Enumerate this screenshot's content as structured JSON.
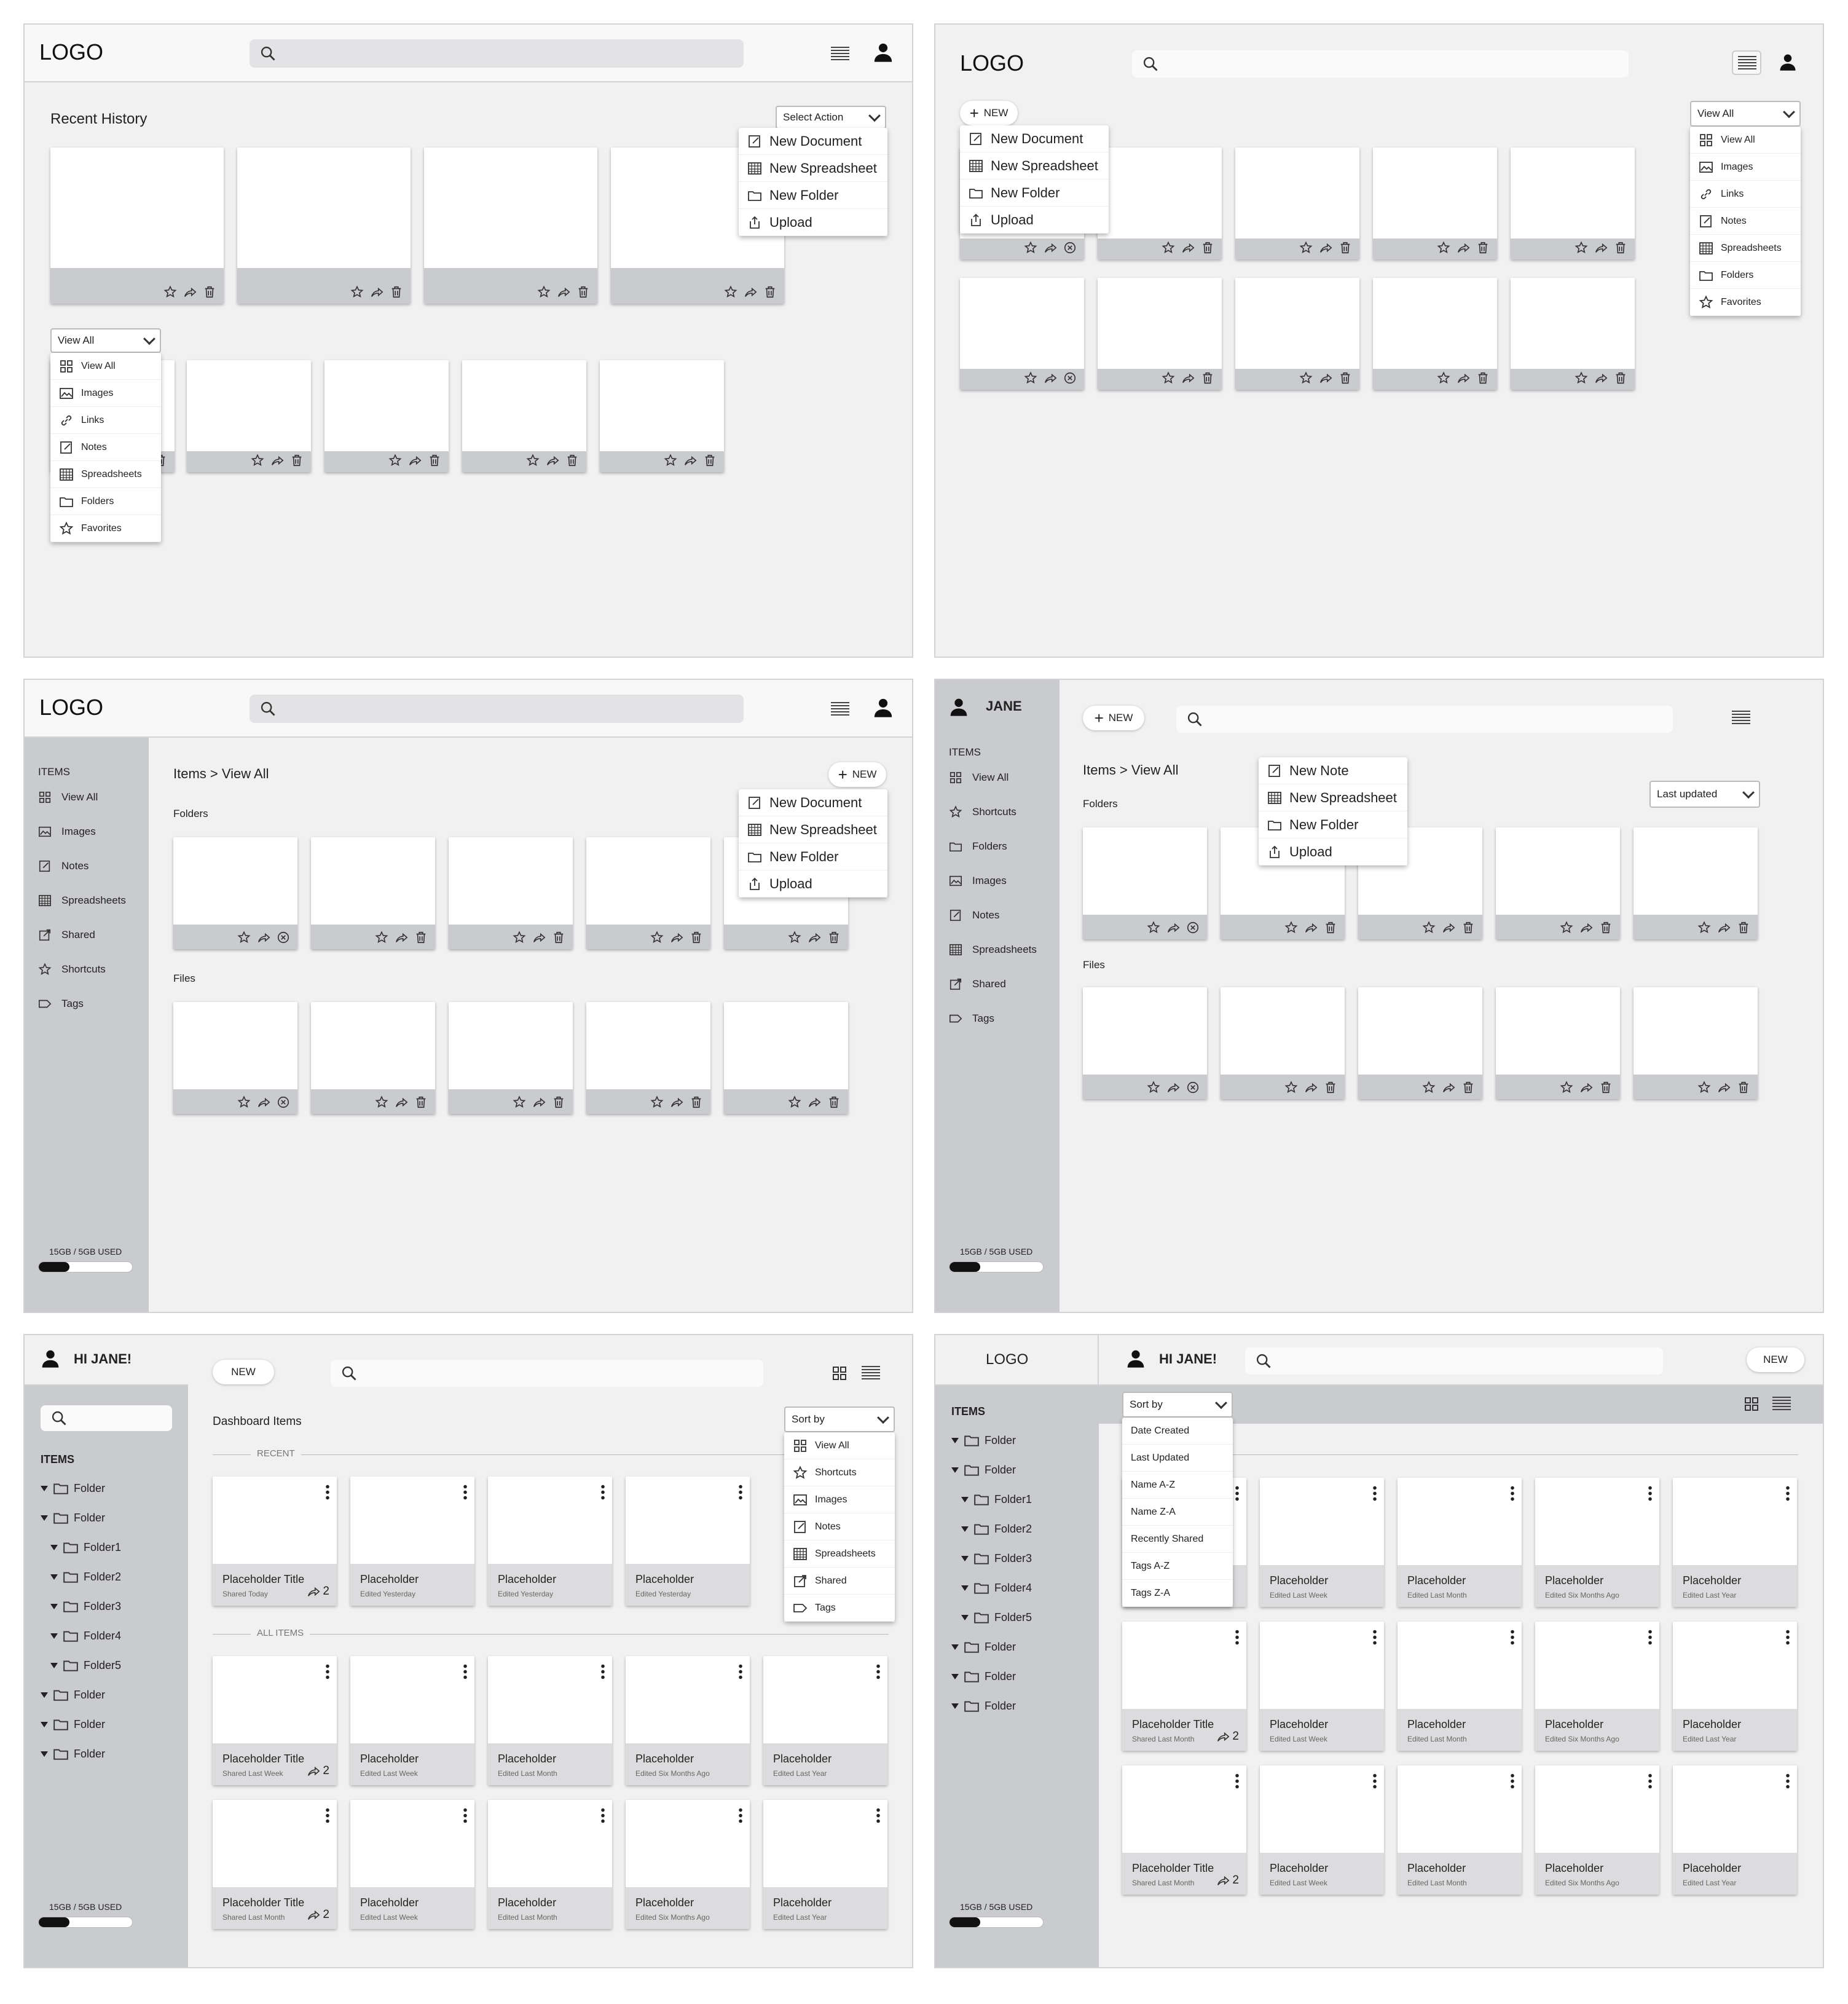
{
  "p1": {
    "logo": "LOGO",
    "title": "Recent History",
    "select_action": "Select Action",
    "new_menu": [
      {
        "icon": "note",
        "label": "New Document"
      },
      {
        "icon": "sheet",
        "label": "New Spreadsheet"
      },
      {
        "icon": "folder",
        "label": "New Folder"
      },
      {
        "icon": "upload",
        "label": "Upload"
      }
    ],
    "filter": "View All",
    "filter_menu": [
      {
        "icon": "grid",
        "label": "View All"
      },
      {
        "icon": "image",
        "label": "Images"
      },
      {
        "icon": "link",
        "label": "Links"
      },
      {
        "icon": "note",
        "label": "Notes"
      },
      {
        "icon": "sheet",
        "label": "Spreadsheets"
      },
      {
        "icon": "folder",
        "label": "Folders"
      },
      {
        "icon": "star",
        "label": "Favorites"
      }
    ]
  },
  "p2": {
    "logo": "LOGO",
    "new": "NEW",
    "filter": "View All",
    "new_menu": [
      {
        "icon": "note",
        "label": "New Document"
      },
      {
        "icon": "sheet",
        "label": "New Spreadsheet"
      },
      {
        "icon": "folder",
        "label": "New Folder"
      },
      {
        "icon": "upload",
        "label": "Upload"
      }
    ],
    "filter_menu": [
      {
        "icon": "grid",
        "label": "View All"
      },
      {
        "icon": "image",
        "label": "Images"
      },
      {
        "icon": "link",
        "label": "Links"
      },
      {
        "icon": "note",
        "label": "Notes"
      },
      {
        "icon": "sheet",
        "label": "Spreadsheets"
      },
      {
        "icon": "folder",
        "label": "Folders"
      },
      {
        "icon": "star",
        "label": "Favorites"
      }
    ]
  },
  "p3": {
    "logo": "LOGO",
    "items": "ITEMS",
    "breadcrumb": "Items > View All",
    "new": "NEW",
    "folders": "Folders",
    "files": "Files",
    "storage": "15GB / 5GB USED",
    "storage_fraction": 0.33,
    "nav": [
      {
        "icon": "grid",
        "label": "View All"
      },
      {
        "icon": "image",
        "label": "Images"
      },
      {
        "icon": "note",
        "label": "Notes"
      },
      {
        "icon": "sheet",
        "label": "Spreadsheets"
      },
      {
        "icon": "shared",
        "label": "Shared"
      },
      {
        "icon": "star",
        "label": "Shortcuts"
      },
      {
        "icon": "tag",
        "label": "Tags"
      }
    ],
    "new_menu": [
      {
        "icon": "note",
        "label": "New Document"
      },
      {
        "icon": "sheet",
        "label": "New Spreadsheet"
      },
      {
        "icon": "folder",
        "label": "New Folder"
      },
      {
        "icon": "upload",
        "label": "Upload"
      }
    ]
  },
  "p4": {
    "user": "JANE",
    "items": "ITEMS",
    "new": "NEW",
    "breadcrumb": "Items > View All",
    "folders": "Folders",
    "files": "Files",
    "sort": "Last updated",
    "storage": "15GB / 5GB USED",
    "storage_fraction": 0.33,
    "nav": [
      {
        "icon": "grid",
        "label": "View All"
      },
      {
        "icon": "star",
        "label": "Shortcuts"
      },
      {
        "icon": "folder",
        "label": "Folders"
      },
      {
        "icon": "image",
        "label": "Images"
      },
      {
        "icon": "note",
        "label": "Notes"
      },
      {
        "icon": "sheet",
        "label": "Spreadsheets"
      },
      {
        "icon": "shared",
        "label": "Shared"
      },
      {
        "icon": "tag",
        "label": "Tags"
      }
    ],
    "new_menu": [
      {
        "icon": "note",
        "label": "New Note"
      },
      {
        "icon": "sheet",
        "label": "New Spreadsheet"
      },
      {
        "icon": "folder",
        "label": "New Folder"
      },
      {
        "icon": "upload",
        "label": "Upload"
      }
    ]
  },
  "p5": {
    "greeting": "HI JANE!",
    "items": "ITEMS",
    "new": "NEW",
    "title": "Dashboard Items",
    "sort": "Sort by",
    "recent": "RECENT",
    "all_items": "ALL ITEMS",
    "storage": "15GB / 5GB USED",
    "storage_fraction": 0.33,
    "tree": [
      "Folder",
      "Folder",
      "Folder1",
      "Folder2",
      "Folder3",
      "Folder4",
      "Folder5",
      "Folder",
      "Folder",
      "Folder"
    ],
    "sort_menu": [
      {
        "icon": "grid",
        "label": "View All"
      },
      {
        "icon": "star",
        "label": "Shortcuts"
      },
      {
        "icon": "image",
        "label": "Images"
      },
      {
        "icon": "note",
        "label": "Notes"
      },
      {
        "icon": "sheet",
        "label": "Spreadsheets"
      },
      {
        "icon": "shared",
        "label": "Shared"
      },
      {
        "icon": "tag",
        "label": "Tags"
      }
    ],
    "recent_cards": [
      {
        "t": "Placeholder Title",
        "s": "Shared Today",
        "n": "2"
      },
      {
        "t": "Placeholder",
        "s": "Edited Yesterday"
      },
      {
        "t": "Placeholder",
        "s": "Edited Yesterday"
      },
      {
        "t": "Placeholder",
        "s": "Edited Yesterday"
      }
    ],
    "all_row1": [
      {
        "t": "Placeholder Title",
        "s": "Shared Last Week",
        "n": "2"
      },
      {
        "t": "Placeholder",
        "s": "Edited Last Week"
      },
      {
        "t": "Placeholder",
        "s": "Edited Last Month"
      },
      {
        "t": "Placeholder",
        "s": "Edited Six Months Ago"
      },
      {
        "t": "Placeholder",
        "s": "Edited Last Year"
      }
    ],
    "all_row2": [
      {
        "t": "Placeholder Title",
        "s": "Shared Last Month",
        "n": "2"
      },
      {
        "t": "Placeholder",
        "s": "Edited Last Week"
      },
      {
        "t": "Placeholder",
        "s": "Edited Last Month"
      },
      {
        "t": "Placeholder",
        "s": "Edited Six Months Ago"
      },
      {
        "t": "Placeholder",
        "s": "Edited Last Year"
      }
    ]
  },
  "p6": {
    "logo": "LOGO",
    "greeting": "HI JANE!",
    "new": "NEW",
    "items": "ITEMS",
    "sort": "Sort by",
    "storage": "15GB / 5GB USED",
    "storage_fraction": 0.33,
    "tree": [
      "Folder",
      "Folder",
      "Folder1",
      "Folder2",
      "Folder3",
      "Folder4",
      "Folder5",
      "Folder",
      "Folder",
      "Folder"
    ],
    "sort_menu": [
      "Date Created",
      "Last Updated",
      "Name A-Z",
      "Name Z-A",
      "Recently Shared",
      "Tags A-Z",
      "Tags Z-A"
    ],
    "row1": [
      {
        "t": "",
        "s": ""
      },
      {
        "t": "Placeholder",
        "s": "Edited Last Week"
      },
      {
        "t": "Placeholder",
        "s": "Edited Last Month"
      },
      {
        "t": "Placeholder",
        "s": "Edited Six Months Ago"
      },
      {
        "t": "Placeholder",
        "s": "Edited Last Year"
      }
    ],
    "row2": [
      {
        "t": "Placeholder Title",
        "s": "Shared Last Month",
        "n": "2"
      },
      {
        "t": "Placeholder",
        "s": "Edited Last Week"
      },
      {
        "t": "Placeholder",
        "s": "Edited Last Month"
      },
      {
        "t": "Placeholder",
        "s": "Edited Six Months Ago"
      },
      {
        "t": "Placeholder",
        "s": "Edited Last Year"
      }
    ],
    "row3": [
      {
        "t": "Placeholder Title",
        "s": "Shared Last Month",
        "n": "2"
      },
      {
        "t": "Placeholder",
        "s": "Edited Last Week"
      },
      {
        "t": "Placeholder",
        "s": "Edited Last Month"
      },
      {
        "t": "Placeholder",
        "s": "Edited Six Months Ago"
      },
      {
        "t": "Placeholder",
        "s": "Edited Last Year"
      }
    ]
  }
}
